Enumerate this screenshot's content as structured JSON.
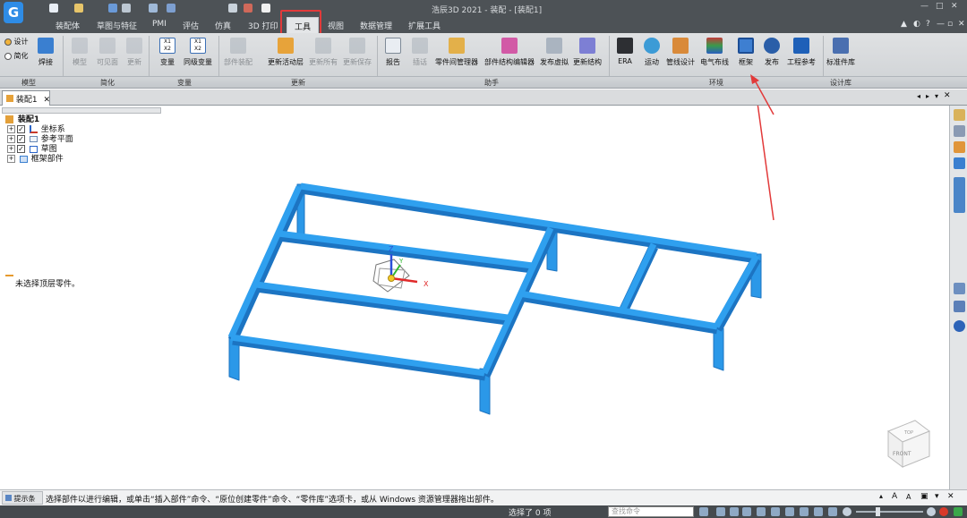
{
  "app": {
    "title": "浩辰3D 2021 - 装配 - [装配1]"
  },
  "tabs": [
    "装配体",
    "草图与特征",
    "PMI",
    "评估",
    "仿真",
    "3D 打印",
    "工具",
    "视图",
    "数据管理",
    "扩展工具"
  ],
  "active_tab": "工具",
  "ribbon": {
    "model_group": {
      "radio1": "设计",
      "radio2": "简化",
      "weld": "焊接",
      "label": "模型"
    },
    "simplify_group": {
      "b1": "模型",
      "b2": "可见面",
      "b3": "更新",
      "label": "简化"
    },
    "variable_group": {
      "b1": "变量",
      "b2": "同级变量",
      "label": "变量"
    },
    "update_group": {
      "b1": "部件装配",
      "b2": "更新活动层",
      "b3": "更新所有",
      "b4": "更新保存",
      "label": "更新"
    },
    "assist_group": {
      "b1": "报告",
      "b2": "插话",
      "b3": "零件间管理器",
      "b4": "部件结构编辑器",
      "b5": "发布虚拟",
      "b6": "更新结构",
      "label": "助手"
    },
    "env_group": {
      "b1": "ERA",
      "b2": "运动",
      "b3": "管线设计",
      "b4": "电气布线",
      "b5": "框架",
      "b6": "发布",
      "b7": "工程参考",
      "label": "环境"
    },
    "lib_group": {
      "b1": "标准件库",
      "label": "设计库"
    }
  },
  "doc_tab": "装配1",
  "tree": {
    "root": "装配1",
    "items": [
      "坐标系",
      "参考平面",
      "草图",
      "框架部件"
    ]
  },
  "left_status": "未选择顶层零件。",
  "status": {
    "label": "提示条",
    "text": "选择部件以进行编辑，或单击“插入部件”命令、“原位创建零件”命令、“零件库”选项卡，或从 Windows 资源管理器拖出部件。"
  },
  "bottom": {
    "selection": "选择了 0 项",
    "search_placeholder": "查找命令"
  },
  "axes": {
    "x": "X",
    "y": "Y",
    "z": "Z"
  },
  "view_cube": {
    "top": "TOP",
    "front": "FRONT"
  },
  "colors": {
    "frame": "#2b98e8",
    "frame_dark": "#1c74c2",
    "highlight": "#e23a3a"
  }
}
